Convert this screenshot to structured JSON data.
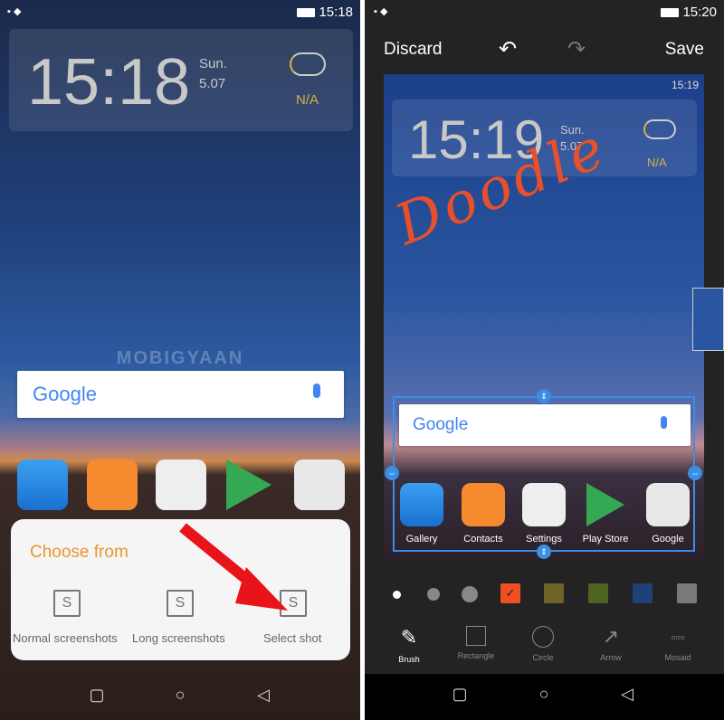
{
  "left_phone": {
    "status": {
      "time": "15:18"
    },
    "widget": {
      "time": "15:18",
      "day": "Sun.",
      "date": "5.07",
      "weather": "N/A"
    },
    "search": {
      "logo": "Google"
    },
    "watermark": "MOBIGYAAN",
    "popup": {
      "title": "Choose from",
      "options": [
        {
          "label": "Normal screenshots"
        },
        {
          "label": "Long screenshots"
        },
        {
          "label": "Select shot"
        }
      ]
    },
    "accent": "#e8962e"
  },
  "right_phone": {
    "status": {
      "time": "15:20"
    },
    "toolbar": {
      "discard": "Discard",
      "save": "Save"
    },
    "preview": {
      "status_time": "15:19",
      "widget": {
        "time": "15:19",
        "day": "Sun.",
        "date": "5.07",
        "weather": "N/A"
      },
      "doodle": "Doodle",
      "search_logo": "Google",
      "apps": [
        {
          "label": "Gallery"
        },
        {
          "label": "Contacts"
        },
        {
          "label": "Settings"
        },
        {
          "label": "Play Store"
        },
        {
          "label": "Google"
        }
      ]
    },
    "palette": {
      "selected_color": "#f04e23",
      "colors": [
        "#f04e23",
        "#6e6428",
        "#4e6420",
        "#1e4278",
        "#7a7a7a"
      ]
    },
    "tools": [
      {
        "label": "Brush",
        "active": true
      },
      {
        "label": "Rectangle"
      },
      {
        "label": "Circle"
      },
      {
        "label": "Arrow"
      },
      {
        "label": "Mosaid"
      }
    ]
  }
}
